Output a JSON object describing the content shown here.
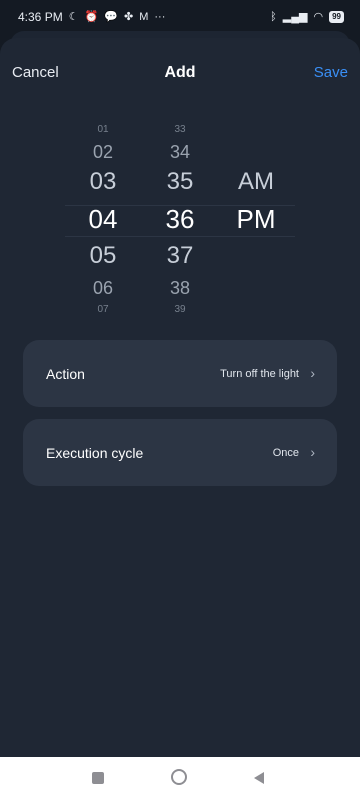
{
  "status_bar": {
    "time": "4:36 PM",
    "left_icons": [
      "moon-icon",
      "alarm-off-icon",
      "chat-icon",
      "fan-icon",
      "mail-icon",
      "more-icon"
    ],
    "right_icons": [
      "bluetooth-icon",
      "signal-icon",
      "wifi-icon"
    ],
    "battery": "99"
  },
  "header": {
    "cancel": "Cancel",
    "title": "Add",
    "save": "Save",
    "save_color": "#3a8ff5"
  },
  "picker": {
    "hours": [
      "01",
      "02",
      "03",
      "04",
      "05",
      "06",
      "07"
    ],
    "minutes": [
      "33",
      "34",
      "35",
      "36",
      "37",
      "38",
      "39"
    ],
    "periods": [
      "AM",
      "PM"
    ],
    "selected": {
      "hour": "04",
      "minute": "36",
      "period": "PM"
    }
  },
  "rows": [
    {
      "label": "Action",
      "value": "Turn off the light"
    },
    {
      "label": "Execution cycle",
      "value": "Once"
    }
  ],
  "colors": {
    "background": "#141a23",
    "sheet": "#1f2734",
    "card": "#2c3544"
  }
}
